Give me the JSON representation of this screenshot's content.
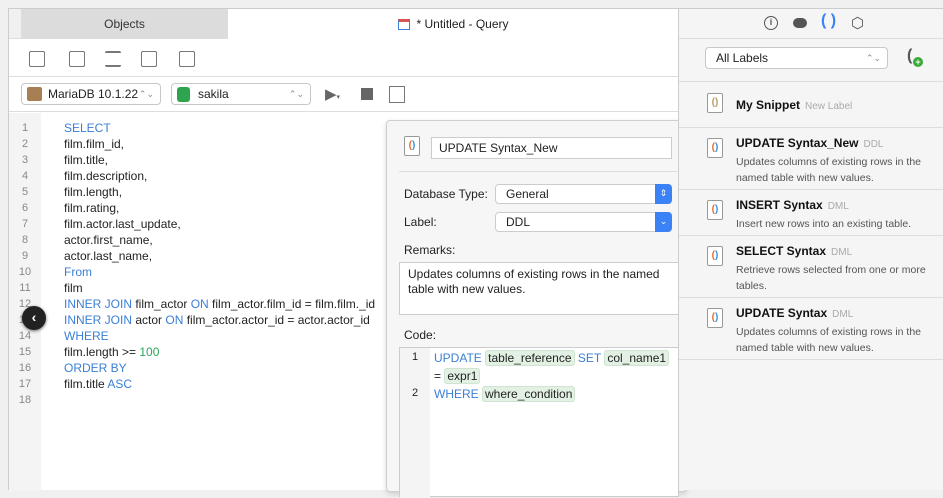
{
  "tabs": {
    "objects": "Objects",
    "query": "* Untitled - Query"
  },
  "toolbar": {
    "connection": "MariaDB 10.1.22",
    "database": "sakila"
  },
  "editor": {
    "line_numbers": [
      "1",
      "2",
      "3",
      "4",
      "5",
      "6",
      "7",
      "8",
      "9",
      "10",
      "11",
      "12",
      "13",
      "14",
      "15",
      "16",
      "17",
      "18"
    ],
    "lines": [
      [
        [
          "kw",
          "SELECT"
        ]
      ],
      [
        [
          "t",
          "film.film_id,"
        ]
      ],
      [
        [
          "t",
          "film.title,"
        ]
      ],
      [
        [
          "t",
          "film.description,"
        ]
      ],
      [
        [
          "t",
          "film.length,"
        ]
      ],
      [
        [
          "t",
          "film.rating,"
        ]
      ],
      [
        [
          "t",
          "film.actor.last_update,"
        ]
      ],
      [
        [
          "t",
          "actor.first_name,"
        ]
      ],
      [
        [
          "t",
          "actor.last_name,"
        ]
      ],
      [
        [
          "kw",
          "From"
        ]
      ],
      [
        [
          "t",
          "film"
        ]
      ],
      [
        [
          "kw",
          "INNER JOIN"
        ],
        [
          "t",
          " film_actor "
        ],
        [
          "kw",
          "ON"
        ],
        [
          "t",
          " film_actor.film_id = film.film._id"
        ]
      ],
      [
        [
          "kw",
          "INNER JOIN"
        ],
        [
          "t",
          " actor "
        ],
        [
          "kw",
          "ON"
        ],
        [
          "t",
          " film_actor.actor_id = actor.actor_id"
        ]
      ],
      [
        [
          "kw",
          "WHERE"
        ]
      ],
      [
        [
          "t",
          "film.length >= "
        ],
        [
          "num",
          "100"
        ]
      ],
      [
        [
          "kw",
          "ORDER BY"
        ]
      ],
      [
        [
          "t",
          "film.title "
        ],
        [
          "kw",
          "ASC"
        ]
      ],
      [
        [
          "t",
          ""
        ]
      ]
    ]
  },
  "popover": {
    "name": "UPDATE Syntax_New",
    "db_type_label": "Database Type:",
    "db_type": "General",
    "label_label": "Label:",
    "label": "DDL",
    "remarks_label": "Remarks:",
    "remarks": "Updates columns of existing rows in the named table with new values.",
    "code_label": "Code:",
    "code": {
      "kw1": "UPDATE",
      "tok1": "table_reference",
      "kw2": "SET",
      "tok2": "col_name1",
      "eq": "=",
      "tok3": "expr1",
      "kw3": "WHERE",
      "tok4": "where_condition"
    },
    "code_lines": [
      "1",
      "2"
    ]
  },
  "right": {
    "filter": "All Labels",
    "snippets": [
      {
        "title": "My Snippet",
        "label": "New Label",
        "desc": ""
      },
      {
        "title": "UPDATE Syntax_New",
        "label": "DDL",
        "desc": "Updates columns of existing rows in the named table with new values."
      },
      {
        "title": "INSERT Syntax",
        "label": "DML",
        "desc": "Insert new rows into an existing table."
      },
      {
        "title": "SELECT Syntax",
        "label": "DML",
        "desc": "Retrieve rows selected from one or more tables."
      },
      {
        "title": "UPDATE Syntax",
        "label": "DML",
        "desc": "Updates columns of existing rows in the named table with new values."
      }
    ]
  },
  "colors": {
    "keyword": "#3a7fd5",
    "number": "#2aa55b",
    "accent": "#3b82f6"
  }
}
